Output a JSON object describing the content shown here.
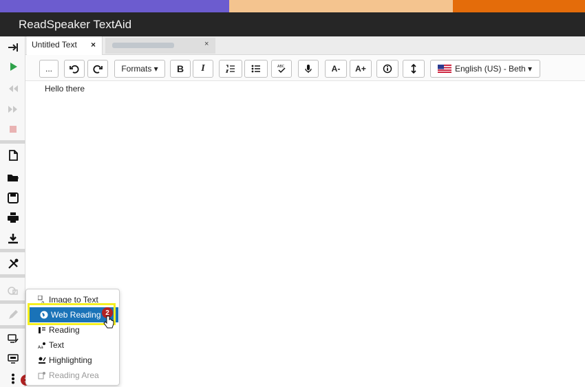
{
  "app": {
    "title": "ReadSpeaker TextAid"
  },
  "colors": {
    "top_bar_1": "#6c5ccf",
    "top_bar_2": "#f4c48f",
    "top_bar_3": "#e46c0a",
    "accent": "#1a73b8",
    "highlight": "#f5ef1f",
    "badge": "#b22222"
  },
  "tabs": {
    "active_label": "Untitled Text",
    "active_close": "×",
    "second_close": "×"
  },
  "toolbar": {
    "more_label": "...",
    "formats_label": "Formats ▾",
    "bold_label": "B",
    "italic_label": "I",
    "font_decrease_label": "A-",
    "font_increase_label": "A+",
    "voice_label": "English (US) - Beth ▾"
  },
  "editor": {
    "content": "Hello there"
  },
  "menu": {
    "items": [
      {
        "label": "Image to Text",
        "icon": "image-to-text-icon"
      },
      {
        "label": "Web Reading",
        "icon": "globe-icon"
      },
      {
        "label": "Reading",
        "icon": "reading-icon"
      },
      {
        "label": "Text",
        "icon": "text-icon"
      },
      {
        "label": "Highlighting",
        "icon": "highlighting-icon"
      },
      {
        "label": "Reading Area",
        "icon": "reading-area-icon"
      }
    ]
  },
  "badges": {
    "step1": "1",
    "step2": "2"
  }
}
